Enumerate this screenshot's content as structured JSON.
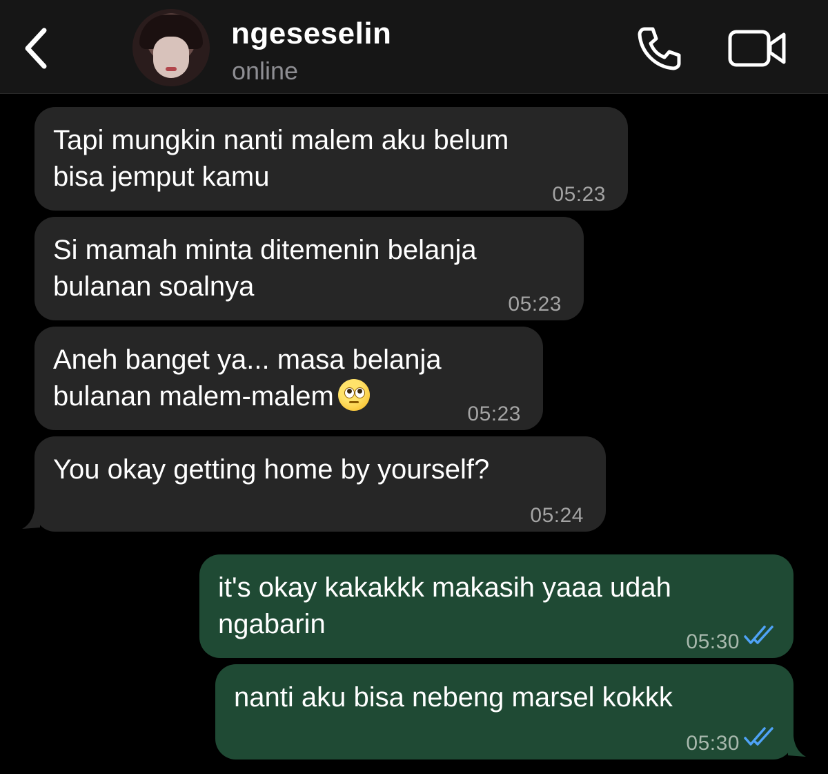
{
  "header": {
    "contact_name": "ngeseselin",
    "status": "online"
  },
  "messages": [
    {
      "direction": "in",
      "line1": "Tapi mungkin nanti malem aku belum",
      "line2": "bisa jemput kamu",
      "time": "05:23"
    },
    {
      "direction": "in",
      "line1": "Si mamah minta ditemenin belanja",
      "line2": "bulanan soalnya",
      "time": "05:23"
    },
    {
      "direction": "in",
      "line1": "Aneh banget ya... masa belanja",
      "line2": "bulanan malem-malem",
      "emoji": "face-with-rolling-eyes",
      "time": "05:23"
    },
    {
      "direction": "in",
      "line1": "You okay getting home by yourself?",
      "time": "05:24"
    },
    {
      "direction": "out",
      "line1": "it's okay kakakkk makasih yaaa udah",
      "line2": "ngabarin",
      "time": "05:30",
      "read": true
    },
    {
      "direction": "out",
      "line1": "nanti aku bisa nebeng marsel kokkk",
      "time": "05:30",
      "read": true
    }
  ],
  "colors": {
    "background": "#000000",
    "header": "#161616",
    "incoming_bubble": "#262626",
    "outgoing_bubble": "#1f4a34",
    "read_ticks": "#4fa3f7"
  }
}
